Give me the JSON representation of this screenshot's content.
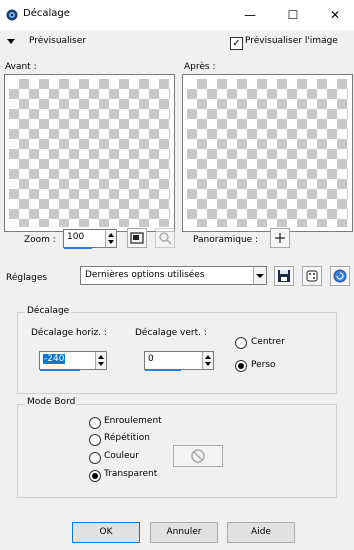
{
  "window": {
    "title": "Décalage",
    "minimize": "—",
    "maximize": "☐",
    "close": "✕"
  },
  "preview": {
    "toggle_label": "Prévisualiser",
    "checkbox_label": "Prévisualiser l'image",
    "checkbox_checked": true
  },
  "panes": {
    "before_label": "Avant :",
    "after_label": "Après :"
  },
  "zoom": {
    "label": "Zoom :",
    "value": "100"
  },
  "pan": {
    "label": "Panoramique :"
  },
  "settings": {
    "label": "Réglages",
    "selected": "Dernières options utilisées"
  },
  "offset": {
    "group_label": "Décalage",
    "horiz_label": "Décalage horiz. :",
    "horiz_value": "-240",
    "vert_label": "Décalage vert. :",
    "vert_value": "0",
    "center_label": "Centrer",
    "custom_label": "Perso",
    "selected": "Perso"
  },
  "edge_mode": {
    "group_label": "Mode Bord",
    "options": [
      "Enroulement",
      "Répétition",
      "Couleur",
      "Transparent"
    ],
    "selected": "Transparent"
  },
  "buttons": {
    "ok": "OK",
    "cancel": "Annuler",
    "help": "Aide"
  },
  "colors": {
    "accent": "#0078d7",
    "title_bar": "#ffffff",
    "window_bg": "#f0f0f0"
  }
}
